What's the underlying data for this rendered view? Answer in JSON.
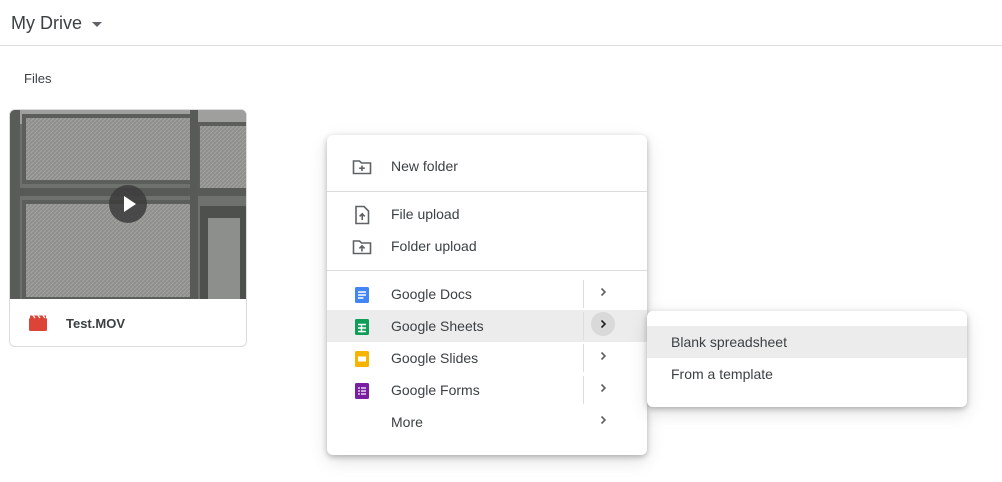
{
  "header": {
    "title": "My Drive"
  },
  "files_section": {
    "label": "Files"
  },
  "files": [
    {
      "name": "Test.MOV",
      "type_icon": "video-file-icon"
    }
  ],
  "new_menu": {
    "new_folder": "New folder",
    "file_upload": "File upload",
    "folder_upload": "Folder upload",
    "google_docs": "Google Docs",
    "google_sheets": "Google Sheets",
    "google_slides": "Google Slides",
    "google_forms": "Google Forms",
    "more": "More",
    "active_item": "Google Sheets"
  },
  "sheets_submenu": {
    "blank": "Blank spreadsheet",
    "template": "From a template",
    "active_item": "Blank spreadsheet"
  },
  "colors": {
    "docs": "#4285f4",
    "sheets": "#0f9d58",
    "slides": "#f4b400",
    "forms": "#7b1fa2",
    "video": "#db4437"
  }
}
